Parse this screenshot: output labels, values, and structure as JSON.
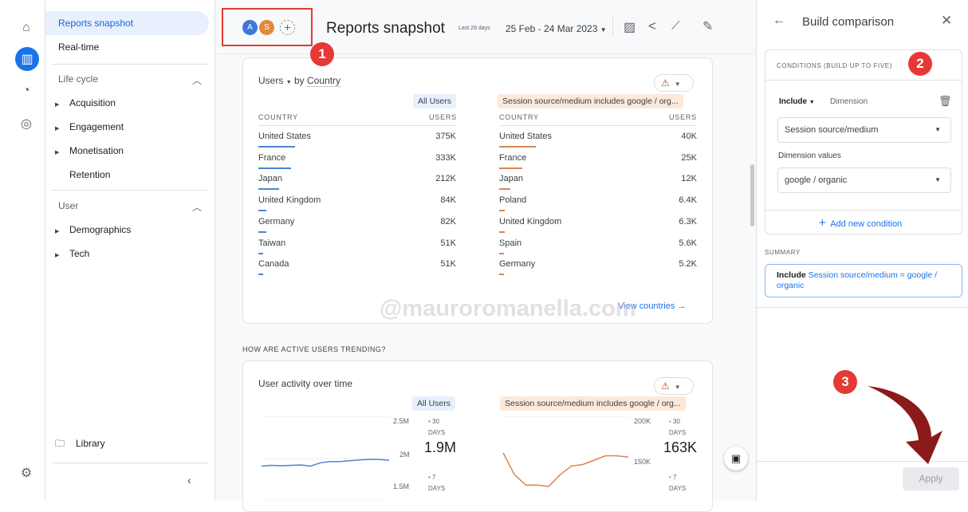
{
  "rail": {
    "icons": [
      "home-icon",
      "reports-icon",
      "explore-icon",
      "advertising-icon",
      "settings-icon"
    ]
  },
  "nav": {
    "reports_snapshot": "Reports snapshot",
    "realtime": "Real-time",
    "lifecycle": "Life cycle",
    "acquisition": "Acquisition",
    "engagement": "Engagement",
    "monetisation": "Monetisation",
    "retention": "Retention",
    "user": "User",
    "demographics": "Demographics",
    "tech": "Tech",
    "library": "Library"
  },
  "header": {
    "avatars": [
      "A",
      "S"
    ],
    "title": "Reports snapshot",
    "date_label": "Last 28 days",
    "date_range": "25 Feb - 24 Mar 2023"
  },
  "country_card": {
    "metric": "Users",
    "by": "by",
    "dimension": "Country",
    "segments": [
      "All Users",
      "Session source/medium includes google / org..."
    ],
    "col_country": "COUNTRY",
    "col_users": "USERS",
    "left_rows": [
      [
        "United States",
        "375K",
        1.0
      ],
      [
        "France",
        "333K",
        0.89
      ],
      [
        "Japan",
        "212K",
        0.57
      ],
      [
        "United Kingdom",
        "84K",
        0.22
      ],
      [
        "Germany",
        "82K",
        0.22
      ],
      [
        "Taiwan",
        "51K",
        0.14
      ],
      [
        "Canada",
        "51K",
        0.14
      ]
    ],
    "right_rows": [
      [
        "United States",
        "40K",
        1.0
      ],
      [
        "France",
        "25K",
        0.63
      ],
      [
        "Japan",
        "12K",
        0.3
      ],
      [
        "Poland",
        "6.4K",
        0.16
      ],
      [
        "United Kingdom",
        "6.3K",
        0.16
      ],
      [
        "Spain",
        "5.6K",
        0.14
      ],
      [
        "Germany",
        "5.2K",
        0.13
      ]
    ],
    "view_link": "View countries"
  },
  "section_title": "HOW ARE ACTIVE USERS TRENDING?",
  "activity_card": {
    "title": "User activity over time",
    "segments": [
      "All Users",
      "Session source/medium includes google / org..."
    ],
    "left": {
      "ticks": [
        "2.5M",
        "2M",
        "1.5M"
      ],
      "legend30": "30",
      "legend7": "7",
      "days": "DAYS",
      "value": "1.9M"
    },
    "right": {
      "ticks": [
        "200K",
        "150K"
      ],
      "legend30": "30",
      "legend7": "7",
      "days": "DAYS",
      "value": "163K"
    }
  },
  "chart_data": [
    {
      "type": "line",
      "ylim": [
        1500000,
        2500000
      ],
      "series": [
        {
          "name": "30 DAYS",
          "color": "#4a86d4",
          "values": [
            1910000,
            1920000,
            1915000,
            1920000,
            1925000,
            1910000,
            1950000,
            1965000,
            1965000,
            1975000,
            1985000,
            1990000,
            1990000,
            1980000
          ]
        }
      ]
    },
    {
      "type": "line",
      "ylim": [
        140000,
        200000
      ],
      "series": [
        {
          "name": "30 DAYS",
          "color": "#d98553",
          "values": [
            175000,
            160000,
            153000,
            153000,
            152000,
            160000,
            166000,
            167000,
            170000,
            173000,
            173000,
            172000
          ]
        }
      ]
    }
  ],
  "watermark": "@mauroromanella.com",
  "panel": {
    "title": "Build comparison",
    "conditions_label": "CONDITIONS (BUILD UP TO FIVE)",
    "include": "Include",
    "dimension": "Dimension",
    "dimension_value": "Session source/medium",
    "dimension_values_label": "Dimension values",
    "dimension_values_value": "google / organic",
    "add_condition": "Add new condition",
    "summary_label": "SUMMARY",
    "summary_include": "Include",
    "summary_text": "Session source/medium = google / organic",
    "apply": "Apply"
  },
  "annotations": [
    "1",
    "2",
    "3"
  ],
  "colors": {
    "accent": "#1a73e8",
    "annotation": "#e53935",
    "arrow": "#8b1a1a",
    "orange": "#d98553"
  }
}
